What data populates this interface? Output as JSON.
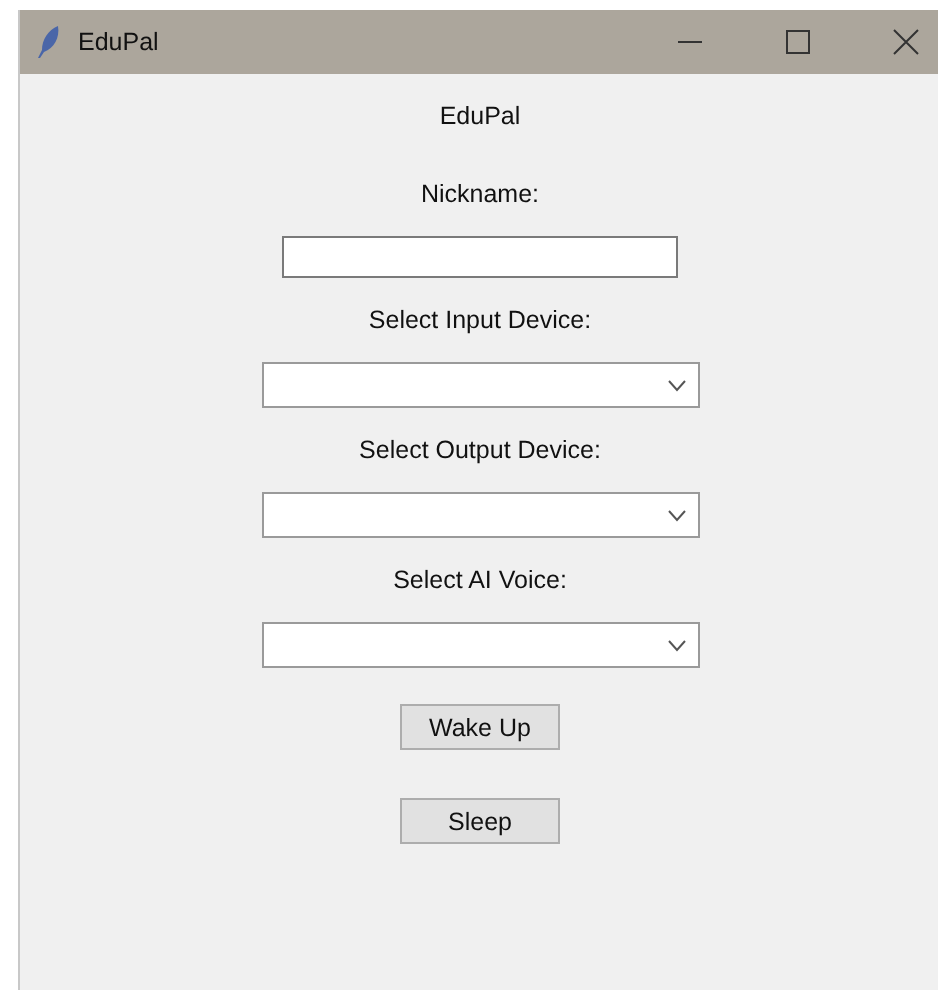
{
  "window": {
    "title": "EduPal"
  },
  "items": [
    {
      "kind": "label",
      "text": "EduPal"
    },
    {
      "kind": "label",
      "text": "Nickname:"
    },
    {
      "kind": "entry"
    },
    {
      "kind": "label",
      "text": "Select Input Device:"
    },
    {
      "kind": "combo"
    },
    {
      "kind": "label",
      "text": "Select Output Device:"
    },
    {
      "kind": "combo"
    },
    {
      "kind": "label",
      "text": "Select AI Voice:"
    },
    {
      "kind": "combo"
    },
    {
      "kind": "button",
      "text": "Wake Up"
    },
    {
      "kind": "button",
      "text": "Sleep"
    }
  ]
}
